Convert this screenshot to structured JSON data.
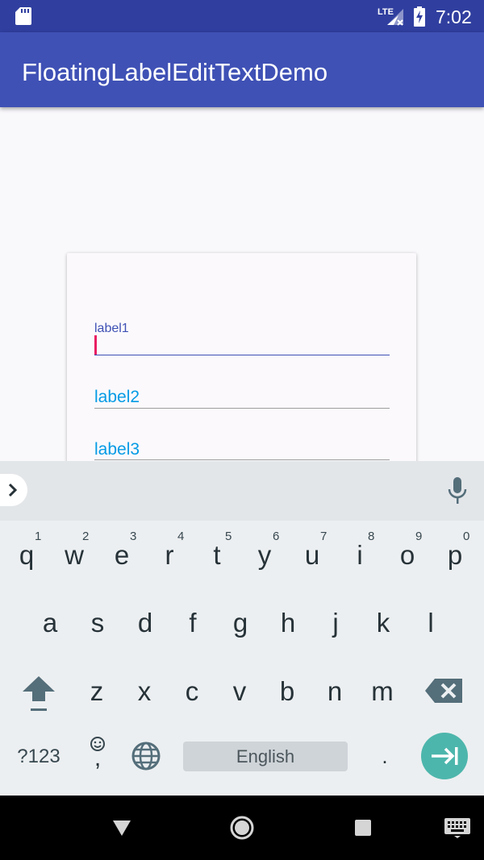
{
  "status_bar": {
    "time": "7:02",
    "network": "LTE",
    "icons": [
      "sd-card-icon",
      "lte-signal-icon",
      "battery-charging-icon"
    ]
  },
  "app_bar": {
    "title": "FloatingLabelEditTextDemo"
  },
  "form": {
    "fields": [
      {
        "label": "label1",
        "state": "focused"
      },
      {
        "label": "label2",
        "state": "idle"
      },
      {
        "label": "label3",
        "state": "idle"
      }
    ]
  },
  "keyboard": {
    "row1": [
      {
        "key": "q",
        "hint": "1"
      },
      {
        "key": "w",
        "hint": "2"
      },
      {
        "key": "e",
        "hint": "3"
      },
      {
        "key": "r",
        "hint": "4"
      },
      {
        "key": "t",
        "hint": "5"
      },
      {
        "key": "y",
        "hint": "6"
      },
      {
        "key": "u",
        "hint": "7"
      },
      {
        "key": "i",
        "hint": "8"
      },
      {
        "key": "o",
        "hint": "9"
      },
      {
        "key": "p",
        "hint": "0"
      }
    ],
    "row2": [
      "a",
      "s",
      "d",
      "f",
      "g",
      "h",
      "j",
      "k",
      "l"
    ],
    "row3": [
      "z",
      "x",
      "c",
      "v",
      "b",
      "n",
      "m"
    ],
    "symbols_label": "?123",
    "emoji_comma": ",",
    "space_label": "English",
    "period": ".",
    "icons": [
      "expand-arrow-icon",
      "mic-icon",
      "shift-icon",
      "backspace-icon",
      "emoji-icon",
      "globe-icon",
      "tab-next-icon"
    ]
  },
  "nav_bar": {
    "icons": [
      "back-icon",
      "home-icon",
      "recents-icon",
      "keyboard-switch-icon"
    ]
  },
  "colors": {
    "primary": "#3f51b5",
    "primary_dark": "#303f9f",
    "accent": "#e91e63",
    "label": "#039be5",
    "keyboard_action": "#4db6ac"
  }
}
